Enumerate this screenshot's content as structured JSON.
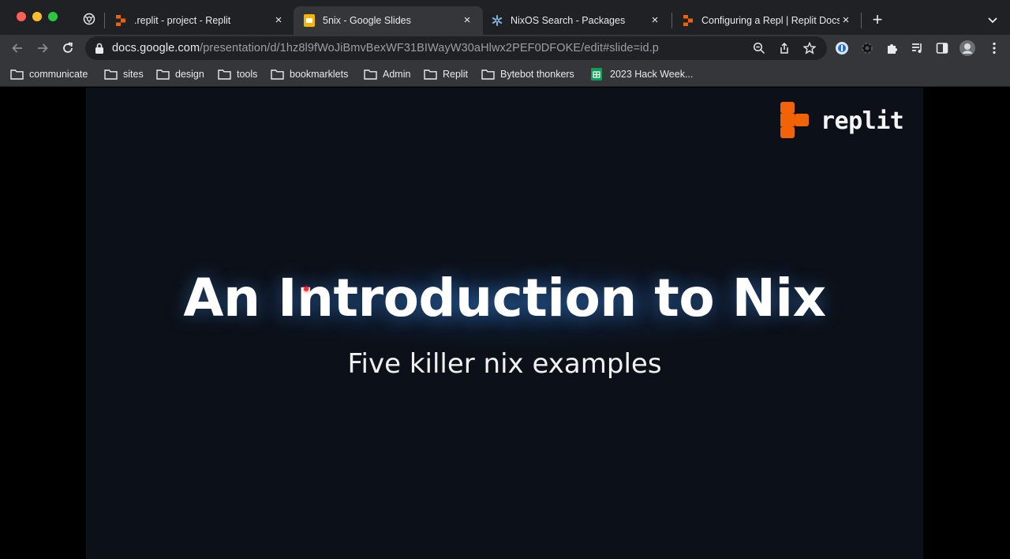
{
  "browser": {
    "tabs": [
      {
        "title": ".replit - project - Replit",
        "icon": "replit-favicon",
        "active": false
      },
      {
        "title": "5nix - Google Slides",
        "icon": "google-slides-favicon",
        "active": true
      },
      {
        "title": "NixOS Search - Packages",
        "icon": "nixos-favicon",
        "active": false
      },
      {
        "title": "Configuring a Repl | Replit Docs",
        "icon": "replit-favicon",
        "active": false
      }
    ],
    "close_label": "×",
    "new_tab_label": "+",
    "url_host": "docs.google.com",
    "url_path": "/presentation/d/1hz8l9fWoJiBmvBexWF31BIWayW30aHlwx2PEF0DFOKE/edit#slide=id.p"
  },
  "bookmarks": [
    {
      "label": "communicate",
      "icon": "folder-icon"
    },
    {
      "label": "sites",
      "icon": "folder-icon"
    },
    {
      "label": "design",
      "icon": "folder-icon"
    },
    {
      "label": "tools",
      "icon": "folder-icon"
    },
    {
      "label": "bookmarklets",
      "icon": "folder-icon"
    },
    {
      "label": "Admin",
      "icon": "folder-icon"
    },
    {
      "label": "Replit",
      "icon": "folder-icon"
    },
    {
      "label": "Bytebot thonkers",
      "icon": "folder-icon"
    },
    {
      "label": "2023 Hack Week...",
      "icon": "google-sheets-icon"
    }
  ],
  "slide": {
    "logo_text": "replit",
    "title": "An Introduction to Nix",
    "subtitle": "Five killer nix examples"
  },
  "colors": {
    "replit_orange": "#f26207",
    "slide_bg": "#0c1018",
    "laser_pointer": "#ff2a2a"
  }
}
